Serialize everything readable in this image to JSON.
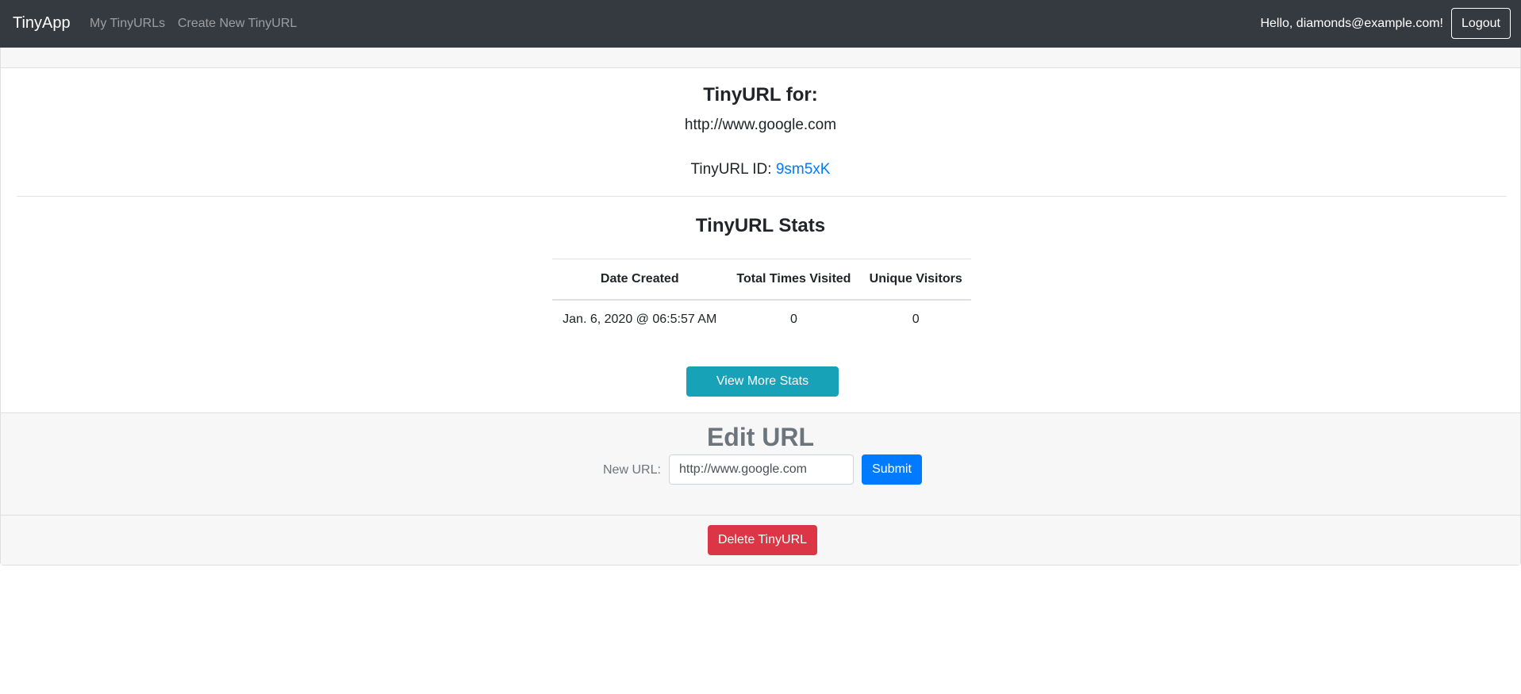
{
  "navbar": {
    "brand": "TinyApp",
    "links": [
      "My TinyURLs",
      "Create New TinyURL"
    ],
    "greeting": "Hello, diamonds@example.com!",
    "logout_label": "Logout",
    "background_color": "#343a40"
  },
  "url_card": {
    "heading": "TinyURL for:",
    "long_url": "http://www.google.com",
    "id_label": "TinyURL ID:",
    "id_value": "9sm5xK"
  },
  "stats": {
    "title": "TinyURL Stats",
    "columns": [
      "Date Created",
      "Total Times Visited",
      "Unique Visitors"
    ],
    "rows": [
      [
        "Jan. 6, 2020 @ 06:5:57 AM",
        "0",
        "0"
      ]
    ],
    "more_button_label": "View More Stats"
  },
  "edit": {
    "title": "Edit URL",
    "field_label": "New URL:",
    "field_value": "http://www.google.com",
    "submit_label": "Submit"
  },
  "footer": {
    "delete_label": "Delete TinyURL"
  },
  "colors": {
    "info_button": "#17a2b8",
    "primary_button": "#007bff",
    "danger_button": "#dc3545",
    "link": "#007bff"
  }
}
